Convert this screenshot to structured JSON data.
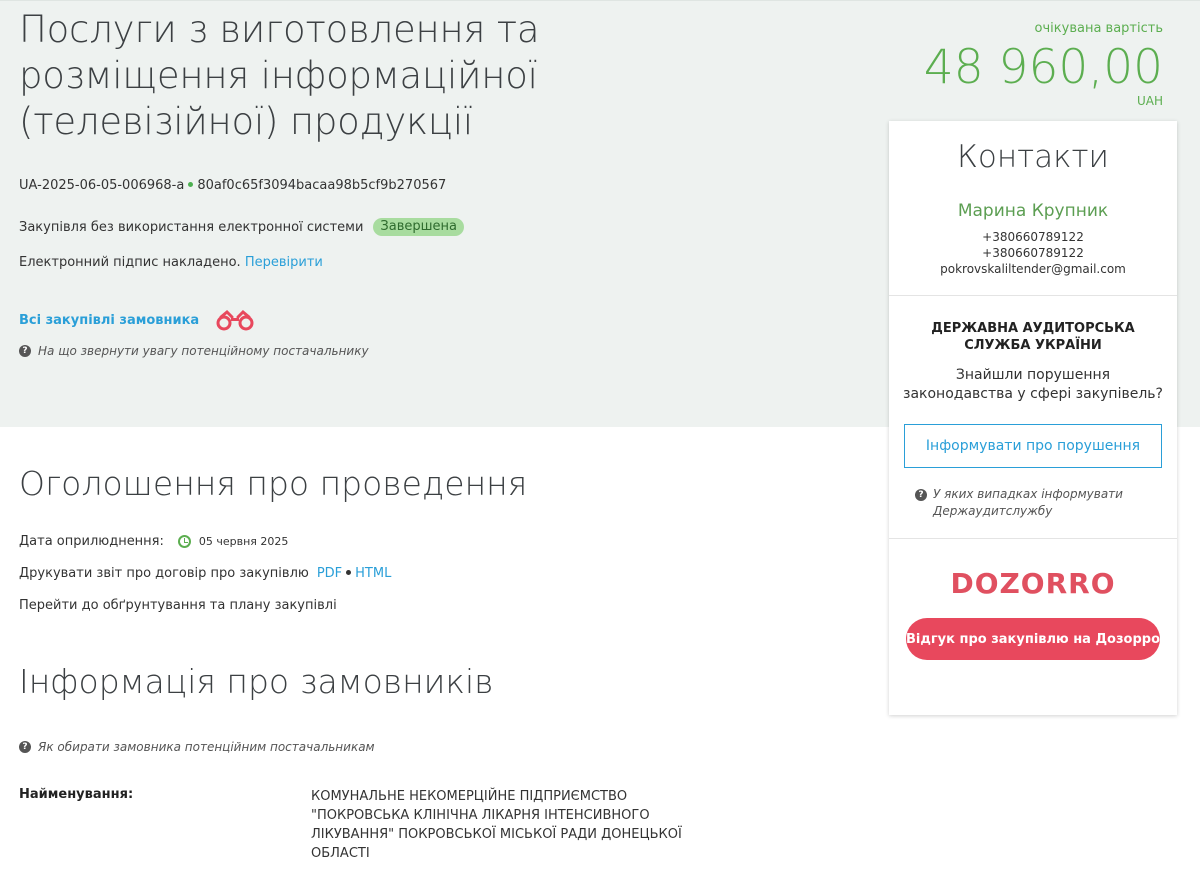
{
  "header": {
    "title": "Послуги з виготовлення та розміщення інформаційної (телевізійної) продукції",
    "tender_id": "UA-2025-06-05-006968-a",
    "tender_hash": "80af0c65f3094bacaa98b5cf9b270567",
    "procedure": "Закупівля без використання електронної системи",
    "status": "Завершена",
    "signature_text": "Електронний підпис накладено.",
    "signature_link": "Перевірити",
    "all_purchases_link": "Всі закупівлі замовника",
    "supplier_hint": "На що звернути увагу потенційному постачальнику",
    "value_label": "очікувана вартість",
    "value_amount": "48 960,00",
    "value_currency": "UAH"
  },
  "contacts": {
    "title": "Контакти",
    "name": "Марина Крупник",
    "phone1": "+380660789122",
    "phone2": "+380660789122",
    "email": "pokrovskaliltender@gmail.com"
  },
  "audit": {
    "title": "ДЕРЖАВНА АУДИТОРСЬКА СЛУЖБА УКРАЇНИ",
    "text": "Знайшли порушення законодавства у сфері закупівель?",
    "button": "Інформувати про порушення",
    "hint": "У яких випадках інформувати Держаудитслужбу"
  },
  "dozorro": {
    "logo": "DOZORRO",
    "button": "Відгук про закупівлю на Дозорро"
  },
  "announcement": {
    "title": "Оголошення про проведення",
    "date_label": "Дата оприлюднення:",
    "date_value": "05 червня 2025",
    "print_label": "Друкувати звіт про договір про закупівлю",
    "pdf_link": "PDF",
    "html_link": "HTML",
    "plan_link": "Перейти до обґрунтування та плану закупівлі"
  },
  "customers": {
    "title": "Інформація про замовників",
    "hint": "Як обирати замовника потенційним постачальникам",
    "name_label": "Найменування:",
    "name_value": "КОМУНАЛЬНЕ НЕКОМЕРЦІЙНЕ ПІДПРИЄМСТВО \"ПОКРОВСЬКА КЛІНІЧНА ЛІКАРНЯ ІНТЕНСИВНОГО ЛІКУВАННЯ\" ПОКРОВСЬКОЇ МІСЬКОЇ РАДИ ДОНЕЦЬКОЇ ОБЛАСТІ"
  },
  "colors": {
    "accent_green": "#5cae50",
    "link_blue": "#2a9fd8",
    "dozorro_red": "#e8485d"
  }
}
